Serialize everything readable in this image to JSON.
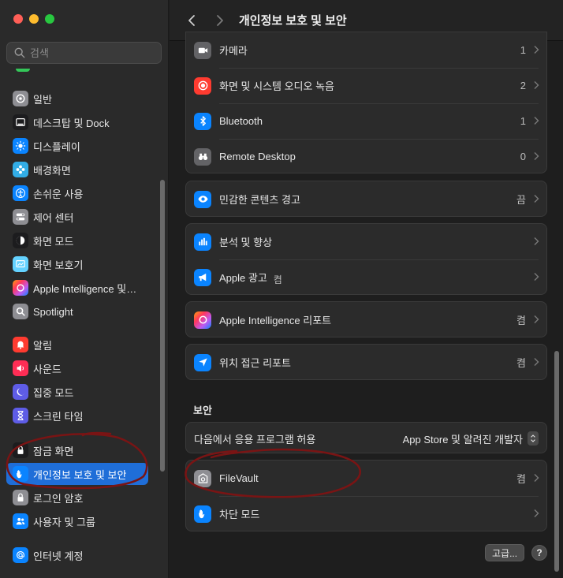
{
  "sidebar": {
    "search": {
      "placeholder": "검색"
    },
    "items": [
      {
        "label": "일반",
        "icon": "gear-icon",
        "color": "#8e8e93"
      },
      {
        "label": "데스크탑 및 Dock",
        "icon": "dock-icon",
        "color": "#1c1c1e"
      },
      {
        "label": "디스플레이",
        "icon": "sun-icon",
        "color": "#0a84ff"
      },
      {
        "label": "배경화면",
        "icon": "flower-icon",
        "color": "#32ade6"
      },
      {
        "label": "손쉬운 사용",
        "icon": "accessibility-icon",
        "color": "#0a84ff"
      },
      {
        "label": "제어 센터",
        "icon": "toggles-icon",
        "color": "#8e8e93"
      },
      {
        "label": "화면 모드",
        "icon": "contrast-icon",
        "color": "#1c1c1e"
      },
      {
        "label": "화면 보호기",
        "icon": "screensaver-icon",
        "color": "#64d2ff"
      },
      {
        "label": "Apple Intelligence 및…",
        "icon": "apple-intelligence-icon",
        "color": "#bf5af2"
      },
      {
        "label": "Spotlight",
        "icon": "magnifier-icon",
        "color": "#8e8e93"
      },
      {
        "label": "알림",
        "icon": "bell-icon",
        "color": "#ff3b30"
      },
      {
        "label": "사운드",
        "icon": "speaker-icon",
        "color": "#ff2d55"
      },
      {
        "label": "집중 모드",
        "icon": "moon-icon",
        "color": "#5e5ce6"
      },
      {
        "label": "스크린 타임",
        "icon": "hourglass-icon",
        "color": "#5e5ce6"
      },
      {
        "label": "잠금 화면",
        "icon": "lock-screen-icon",
        "color": "#1c1c1e"
      },
      {
        "label": "개인정보 보호 및 보안",
        "icon": "hand-icon",
        "color": "#0a84ff",
        "active": true
      },
      {
        "label": "로그인 암호",
        "icon": "lock-icon",
        "color": "#8e8e93"
      },
      {
        "label": "사용자 및 그룹",
        "icon": "users-icon",
        "color": "#0a84ff"
      },
      {
        "label": "인터넷 계정",
        "icon": "at-icon",
        "color": "#0a84ff"
      }
    ]
  },
  "toolbar": {
    "title": "개인정보 보호 및 보안"
  },
  "privacy_group": [
    {
      "label": "카메라",
      "value": "1",
      "icon": "camera-icon",
      "color": "#636366"
    },
    {
      "label": "화면 및 시스템 오디오 녹음",
      "value": "2",
      "icon": "record-icon",
      "color": "#ff3b30"
    },
    {
      "label": "Bluetooth",
      "value": "1",
      "icon": "bluetooth-icon",
      "color": "#0a84ff"
    },
    {
      "label": "Remote Desktop",
      "value": "0",
      "icon": "binoculars-icon",
      "color": "#636366"
    }
  ],
  "sensitive": {
    "label": "민감한 콘텐츠 경고",
    "value": "끔",
    "icon": "eye-icon",
    "color": "#0a84ff"
  },
  "analytics_group": [
    {
      "label": "분석 및 향상",
      "value": "",
      "icon": "chart-icon",
      "color": "#0a84ff"
    },
    {
      "label": "Apple 광고",
      "value": "켬",
      "icon": "megaphone-icon",
      "color": "#0a84ff"
    }
  ],
  "ai_report": {
    "label": "Apple Intelligence 리포트",
    "value": "켬",
    "icon": "apple-intelligence-icon",
    "color": "#bf5af2"
  },
  "location_report": {
    "label": "위치 접근 리포트",
    "value": "켬",
    "icon": "location-arrow-icon",
    "color": "#0a84ff"
  },
  "security": {
    "section_title": "보안",
    "allow_label": "다음에서 응용 프로그램 허용",
    "allow_value": "App Store 및 알려진 개발자",
    "items": [
      {
        "label": "FileVault",
        "value": "켬",
        "icon": "filevault-icon",
        "color": "#8e8e93"
      },
      {
        "label": "차단 모드",
        "value": "",
        "icon": "hand-icon",
        "color": "#0a84ff"
      }
    ]
  },
  "footer": {
    "advanced_label": "고급...",
    "help_label": "?"
  },
  "annotation_color": "#7a1414"
}
